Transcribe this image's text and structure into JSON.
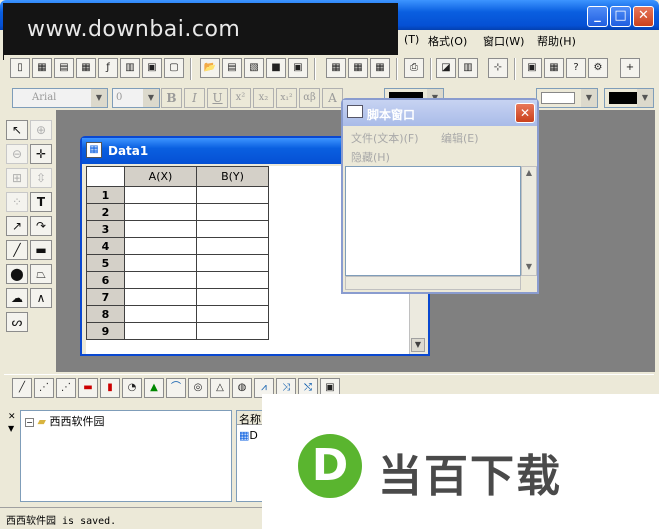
{
  "watermark": {
    "text": "www.downbai.com"
  },
  "menubar": {
    "items": [
      {
        "label": "(T)"
      },
      {
        "label": "格式(O)"
      },
      {
        "label": "窗口(W)"
      },
      {
        "label": "帮助(H)"
      }
    ]
  },
  "format_toolbar": {
    "font_value": "Arial",
    "size_value": "0",
    "bold": "B",
    "italic": "I",
    "underline": "U",
    "superscript": "x²",
    "subscript": "x₂",
    "supsub": "x₁²",
    "greek": "αβ",
    "font_size_up": "A"
  },
  "data_window": {
    "title": "Data1",
    "columns": [
      "A(X)",
      "B(Y)"
    ],
    "rows": [
      "1",
      "2",
      "3",
      "4",
      "5",
      "6",
      "7",
      "8",
      "9"
    ]
  },
  "script_window": {
    "title": "脚本窗口",
    "menu_file": "文件(文本)(F)",
    "menu_edit": "编辑(E)",
    "menu_hide": "隐藏(H)"
  },
  "explorer": {
    "root_folder": "西西软件园",
    "list_header": "名称",
    "list_item": "D"
  },
  "logo": {
    "text": "当百下载",
    "mark": "D"
  },
  "status": {
    "text": "西西软件园 is saved."
  },
  "colors": {
    "titlebar": "#0a5fe0",
    "logo_green": "#5ab52f",
    "logo_text": "#4a4a4a",
    "mdi_background": "#808080"
  }
}
